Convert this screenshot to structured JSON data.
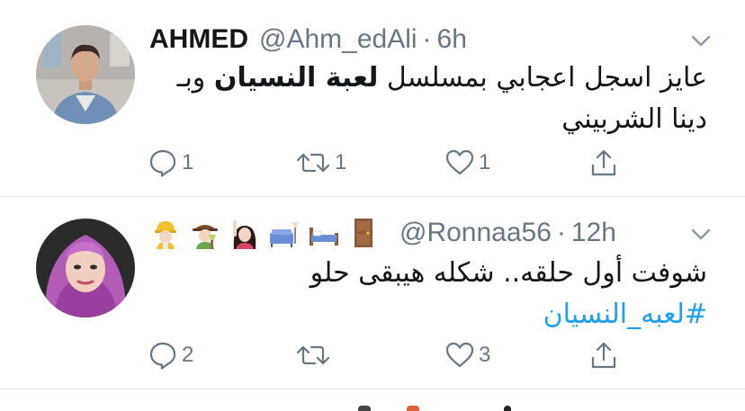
{
  "tweets": [
    {
      "name": "AHMED",
      "handle": "@Ahm_edAli",
      "separator": "·",
      "time": "6h",
      "text_pre": "عايز اسجل اعجابي بمسلسل ",
      "text_bold": "لعبة النسيان",
      "text_post": " وبـ دينا الشربيني",
      "avatar_icon": "avatar-ahmed",
      "actions": {
        "reply_count": "1",
        "retweet_count": "1",
        "like_count": "1",
        "share_count": ""
      }
    },
    {
      "name": "",
      "handle": "@Ronnaa56",
      "separator": "·",
      "time": "12h",
      "emoji_icons": [
        "construction-worker-woman-icon",
        "farmer-woman-icon",
        "raising-hand-woman-icon",
        "couch-lamp-icon",
        "bed-icon",
        "door-icon"
      ],
      "text_line": "شوفت أول حلقه.. شكله هيبقى حلو",
      "hashtag": "#لعبه_النسيان",
      "avatar_icon": "avatar-ronnaa",
      "actions": {
        "reply_count": "2",
        "retweet_count": "",
        "like_count": "3",
        "share_count": ""
      }
    }
  ],
  "colors": {
    "text": "#14171a",
    "muted": "#657786",
    "link": "#1da1f2",
    "divider": "#e1e8ed"
  }
}
